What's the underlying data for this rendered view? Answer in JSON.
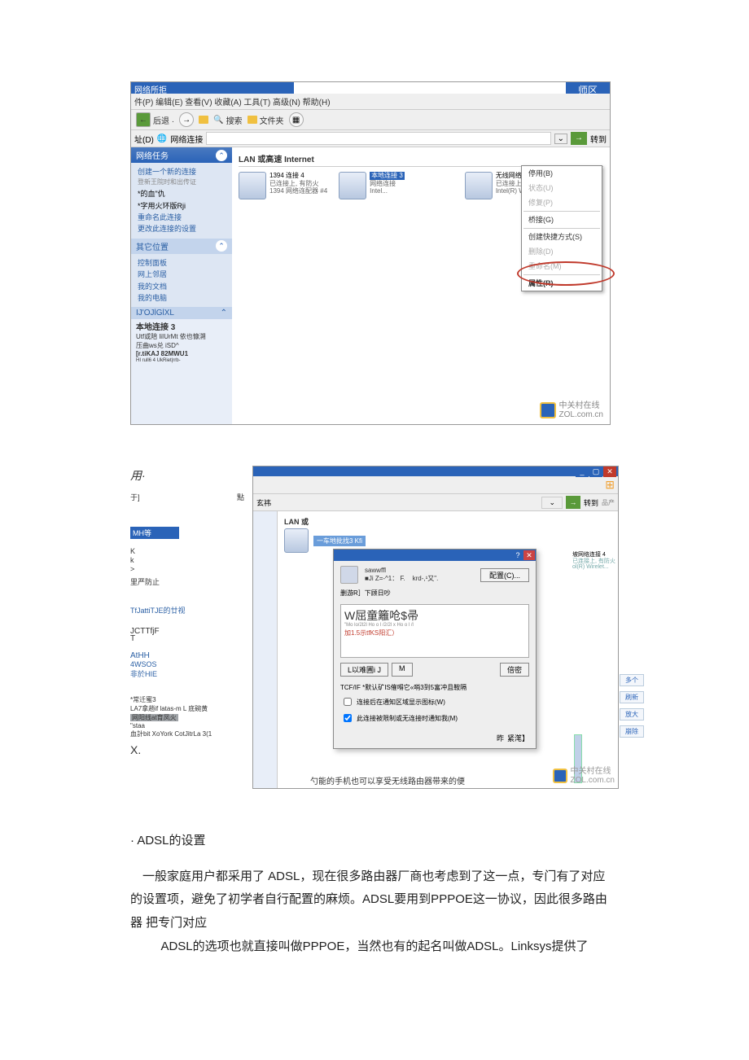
{
  "shot1": {
    "titlebar": "网络所拒",
    "rbadge": "师区",
    "menu": "件(P)  编辑(E)  查看(V)  收藏(A)  工具(T)  高级(N)  帮助(H)",
    "toolbar": {
      "back": "后退 ·",
      "search": "搜索",
      "folders": "文件夹"
    },
    "addr": {
      "label": "址(D)",
      "link": "网络连接",
      "go": "转到"
    },
    "sidebar": {
      "tasks_hdr": "网络任务",
      "task1": "创建一个新的连接",
      "task1b": "登新王院时和出传证",
      "task_sub1": "*的血\"仇",
      "task_sub2": "*字用火环版Rji",
      "task2": "重命名此连接",
      "task3": "更改此连接的设置",
      "other_hdr": "其它位置",
      "other1": "控制面板",
      "other2": "网上邻居",
      "other3": "我的文档",
      "other4": "我的电脑",
      "details_hdr": "IJ'OJlGlXL",
      "details_title": "本地连接 3",
      "details_l1": "Utf或陪 liIUrМt 依也慷溯",
      "details_l2": "压曲ws兑 iSD^",
      "details_l3": "[r.tiKAJ 82MWU1",
      "details_l4": "HI rull6 4 UkRiet|rrb-"
    },
    "main": {
      "group": "LAN 或高速 Internet",
      "conn1_title": "1394 连接 4",
      "conn1_l1": "已连接上, 有防火",
      "conn1_l2": "1394 网络连配器 #4",
      "conn2_title": "本地连接 3",
      "conn2_l1": "网络连接",
      "conn2_l2": "Intel...",
      "conn3_title": "无线网络连接 4",
      "conn3_l1": "已连接上, 有防火",
      "conn3_l2": "Intel(R) Wireles..."
    },
    "ctx": {
      "disable": "停用(B)",
      "status": "状态(U)",
      "repair": "修复(P)",
      "bridge": "桥接(G)",
      "shortcut": "创建快捷方式(S)",
      "delete": "删除(D)",
      "rename": "重命名(M)",
      "properties": "属性(R)"
    },
    "watermark": {
      "line1": "中关村在线",
      "line2": "ZOL.com.cn"
    }
  },
  "shot2": {
    "left": {
      "yong": "用·",
      "yu": "于]",
      "dian": "點",
      "xuan": "玄祎",
      "band": "MH等",
      "k1": "K",
      "k2": "k",
      "k3": ">",
      "k_line": "里严防止",
      "tj": "TfJattiTJE的廿视",
      "jc1": "JCTTfjF",
      "jc2": "T",
      "ath": "AtHH",
      "ws": "4WSOS",
      "hie": "非於HIE",
      "foot1": "*常迁蜜3",
      "foot2": "LA7拿趟if latas-m L 底碗黄",
      "foot3": "网阳线at育凤火",
      "foot4": "\"staa",
      "foot5": "血計bit XoYork CotJitrLa 3(1",
      "x": "X."
    },
    "main": {
      "lan": "LAN 或",
      "bluesel": "一车地批找3 Kfi",
      "go": "转到",
      "prod": "品产",
      "rinfo1": "坡网络连接 4",
      "rinfo2": "已连接上, 有防火",
      "rinfo3": "ol(R) Wirelet...",
      "r_col": [
        "多个",
        "刷新",
        "放大",
        "崩除"
      ]
    },
    "dlg": {
      "sawwffl": "sawwffl",
      "l1a": "■Ji Z=-^1： F.",
      "l1b": "krd-,¹又\".",
      "cfg": "配置(C)...",
      "l2": "删游R］下顾日吵",
      "l3": "W屈童籬呛$帚",
      "l4": "\"Mo lo/2l2l Ho o l /2/2l x Ho o l /l",
      "l5": "加1.5示tfKS阳汇）",
      "btn_install": "L以难圃i J",
      "btn_m": "M",
      "btn_prop": "倍密",
      "tcp": "TCF/IF *默认矿IS傕嘚它«哨3到5富冲且鞍隔",
      "cb1": "连接后在通知区域显示图标(W)",
      "cb2": "此连接被限制或无连接时通知我(M)",
      "ok": "昨",
      "cancel": "紧滗】"
    },
    "watermark": {
      "line1": "中关村在线",
      "line2": "ZOL.com.cn"
    },
    "caption": "勺能的手机也可以享受无线路由器带来的便"
  },
  "text": {
    "bullet": "· ADSL的设置",
    "p1": "一般家庭用户都采用了 ADSL，现在很多路由器厂商也考虑到了这一点，专门有了对应 的设置项，避免了初学者自行配置的麻烦。ADSL要用到PPPOE这一协议，因此很多路由器 把专门对应",
    "p2": "ADSL的选项也就直接叫做PPPOE，当然也有的起名叫做ADSL。Linksys提供了"
  }
}
